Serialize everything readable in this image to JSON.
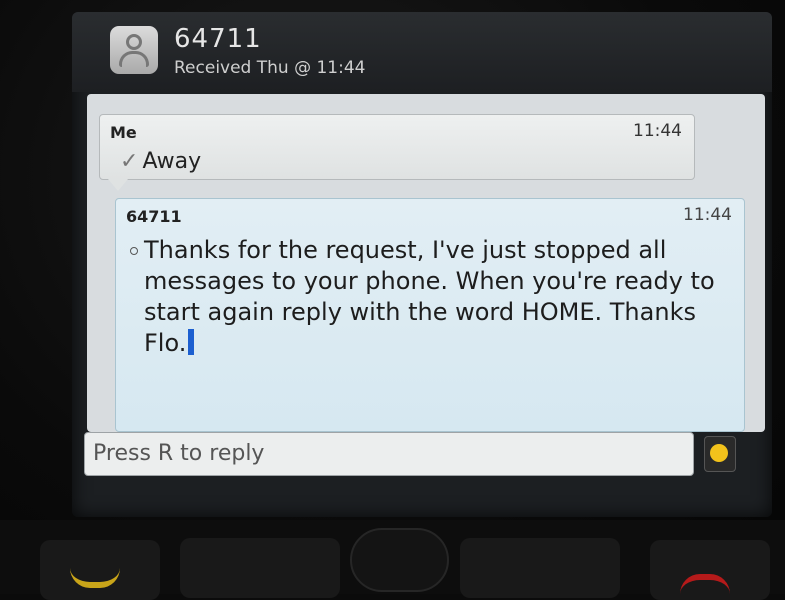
{
  "header": {
    "sender": "64711",
    "received": "Received Thu @ 11:44"
  },
  "thread": {
    "messages": [
      {
        "from": "Me",
        "time": "11:44",
        "text": "Away",
        "status_icon": "check-icon"
      },
      {
        "from": "64711",
        "time": "11:44",
        "text": "Thanks for the request, I've just stopped all messages to your phone. When you're ready to start again reply with the word HOME. Thanks Flo."
      }
    ]
  },
  "reply": {
    "placeholder": "Press R to reply"
  },
  "colors": {
    "incoming_bubble": "#d6e8f1",
    "cursor": "#1c5fd0",
    "emoji": "#f2c21b"
  }
}
